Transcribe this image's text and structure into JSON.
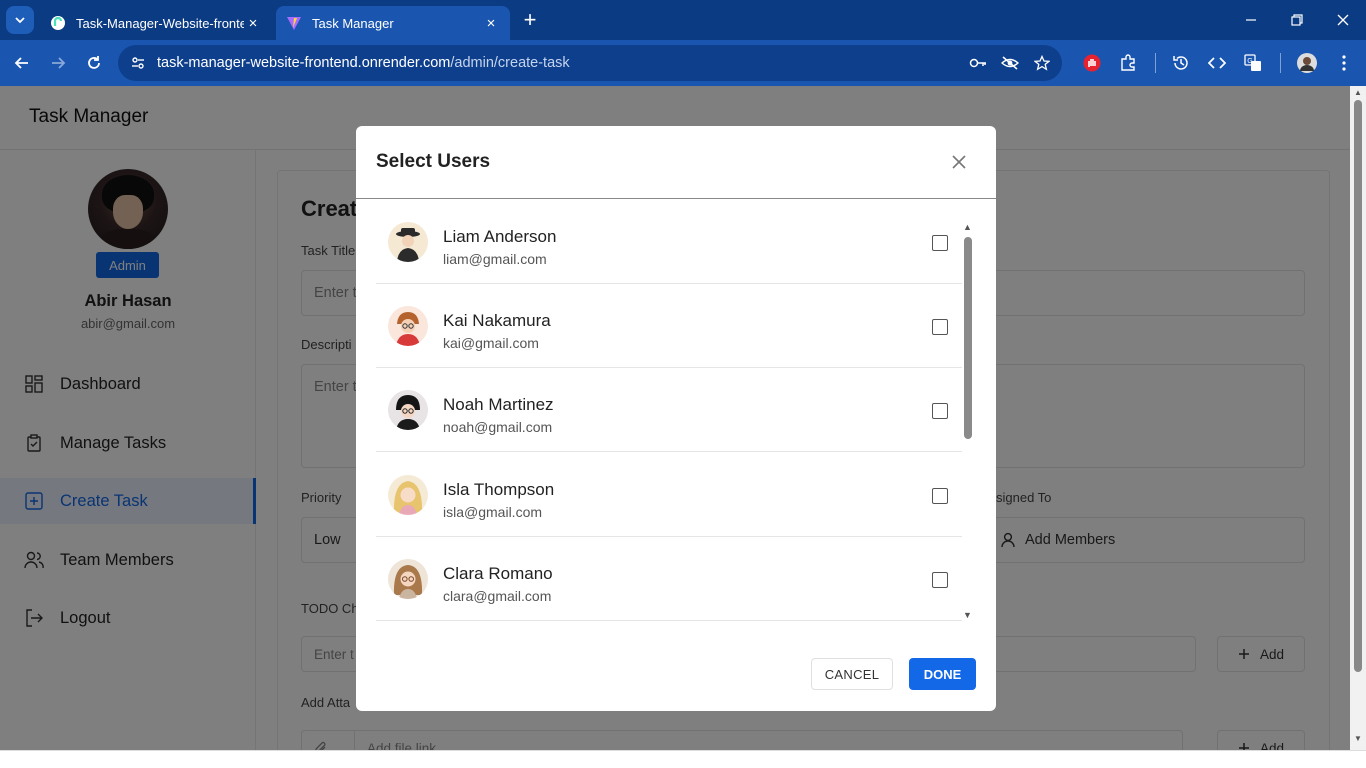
{
  "browser": {
    "tabs": [
      {
        "title": "Task-Manager-Website-fronten",
        "active": false
      },
      {
        "title": "Task Manager",
        "active": true
      }
    ],
    "url_host": "task-manager-website-frontend.onrender.com",
    "url_path": "/admin/create-task"
  },
  "app": {
    "brand": "Task Manager"
  },
  "sidebar": {
    "role_badge": "Admin",
    "user_name": "Abir Hasan",
    "user_email": "abir@gmail.com",
    "items": [
      {
        "label": "Dashboard",
        "icon": "grid-icon"
      },
      {
        "label": "Manage Tasks",
        "icon": "clipboard-icon"
      },
      {
        "label": "Create Task",
        "icon": "plus-square-icon",
        "active": true
      },
      {
        "label": "Team Members",
        "icon": "users-icon"
      },
      {
        "label": "Logout",
        "icon": "logout-icon"
      }
    ]
  },
  "form": {
    "title": "Creat",
    "task_title_label": "Task Title",
    "task_title_placeholder": "Enter t",
    "description_label": "Descripti",
    "description_placeholder": "Enter t",
    "priority_label": "Priority",
    "priority_value": "Low",
    "assigned_label": "signed To",
    "add_members_label": "Add Members",
    "todo_label": "TODO Ch",
    "todo_placeholder": "Enter t",
    "add_label": "Add",
    "attach_label": "Add Atta",
    "file_link_placeholder": "Add file link",
    "add_attach_label": "Add"
  },
  "modal": {
    "title": "Select Users",
    "users": [
      {
        "name": "Liam Anderson",
        "email": "liam@gmail.com",
        "checked": false
      },
      {
        "name": "Kai Nakamura",
        "email": "kai@gmail.com",
        "checked": false
      },
      {
        "name": "Noah Martinez",
        "email": "noah@gmail.com",
        "checked": false
      },
      {
        "name": "Isla Thompson",
        "email": "isla@gmail.com",
        "checked": false
      },
      {
        "name": "Clara Romano",
        "email": "clara@gmail.com",
        "checked": false
      }
    ],
    "cancel_label": "CANCEL",
    "done_label": "DONE"
  },
  "colors": {
    "accent": "#1368e8",
    "browser_frame": "#0b3b82"
  }
}
